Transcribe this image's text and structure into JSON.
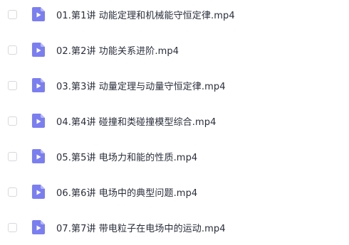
{
  "file_list": {
    "items": [
      {
        "name": "01.第1讲 动能定理和机械能守恒定律.mp4",
        "type": "video",
        "icon": "video-file-icon",
        "checked": false
      },
      {
        "name": "02.第2讲 功能关系进阶.mp4",
        "type": "video",
        "icon": "video-file-icon",
        "checked": false
      },
      {
        "name": "03.第3讲 动量定理与动量守恒定律.mp4",
        "type": "video",
        "icon": "video-file-icon",
        "checked": false
      },
      {
        "name": "04.第4讲 碰撞和类碰撞模型综合.mp4",
        "type": "video",
        "icon": "video-file-icon",
        "checked": false
      },
      {
        "name": "05.第5讲 电场力和能的性质.mp4",
        "type": "video",
        "icon": "video-file-icon",
        "checked": false
      },
      {
        "name": "06.第6讲 电场中的典型问题.mp4",
        "type": "video",
        "icon": "video-file-icon",
        "checked": false
      },
      {
        "name": "07.第7讲 带电粒子在电场中的运动.mp4",
        "type": "video",
        "icon": "video-file-icon",
        "checked": false
      }
    ],
    "icon_color": "#7b7ef0",
    "icon_fold_color": "#b7b9f7"
  }
}
